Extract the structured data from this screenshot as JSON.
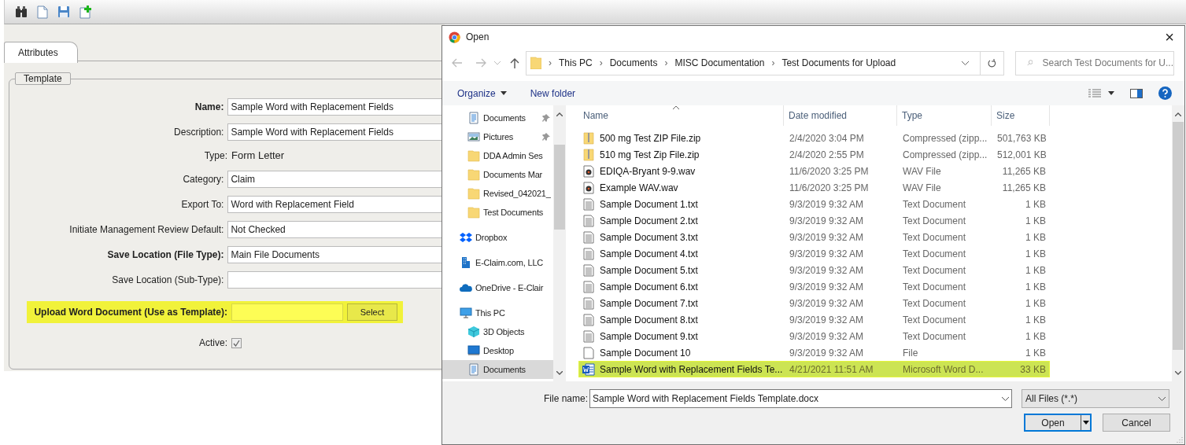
{
  "tabs": [
    {
      "label": "Attributes",
      "selected": true
    }
  ],
  "fieldset": {
    "legend": "Template"
  },
  "fields": [
    {
      "label": "Name:",
      "bold": true,
      "kind": "input",
      "value": "Sample Word with Replacement Fields"
    },
    {
      "label": "Description:",
      "bold": false,
      "kind": "input",
      "value": "Sample Word with Replacement Fields"
    },
    {
      "label": "Type:",
      "bold": false,
      "kind": "text",
      "value": "Form Letter"
    },
    {
      "label": "Category:",
      "bold": false,
      "kind": "input",
      "value": "Claim"
    },
    {
      "label": "Export To:",
      "bold": false,
      "kind": "input",
      "value": "Word with Replacement Field"
    },
    {
      "label": "Initiate Management Review Default:",
      "bold": false,
      "kind": "input",
      "value": "Not Checked"
    },
    {
      "label": "Save Location (File Type):",
      "bold": true,
      "kind": "input",
      "value": "Main File Documents"
    },
    {
      "label": "Save Location (Sub-Type):",
      "bold": false,
      "kind": "input"
    },
    {
      "label": "Upload Word Document (Use as Template):",
      "bold": true,
      "kind": "upload",
      "highlighted": true,
      "button": "Select"
    },
    {
      "label": "Active:",
      "bold": false,
      "kind": "checkbox",
      "checked": true
    }
  ],
  "dialog": {
    "title": "Open",
    "close": "×",
    "breadcrumb_separator": "›",
    "breadcrumb": [
      "This PC",
      "Documents",
      "MISC Documentation",
      "Test Documents for Upload"
    ],
    "search_placeholder": "Search Test Documents for U...",
    "commands": [
      {
        "label": "Organize",
        "menu": true
      },
      {
        "label": "New folder",
        "menu": false
      }
    ],
    "nav": [
      {
        "label": "Documents",
        "kind": "docs",
        "pinned": true,
        "selected": false
      },
      {
        "label": "Pictures",
        "kind": "pictures",
        "pinned": true,
        "selected": false
      },
      {
        "label": "DDA Admin Ses",
        "kind": "folder",
        "pinned": false,
        "selected": false
      },
      {
        "label": "Documents Mar",
        "kind": "folder",
        "pinned": false,
        "selected": false
      },
      {
        "label": "Revised_042021_",
        "kind": "folder",
        "pinned": false,
        "selected": false
      },
      {
        "label": "Test Documents",
        "kind": "folder",
        "pinned": false,
        "selected": false
      },
      {
        "label": "Dropbox",
        "kind": "dropbox",
        "pinned": false,
        "selected": false
      },
      {
        "label": "E-Claim.com, LLC",
        "kind": "building",
        "pinned": false,
        "selected": false
      },
      {
        "label": "OneDrive - E-Clair",
        "kind": "cloud",
        "pinned": false,
        "selected": false
      },
      {
        "label": "This PC",
        "kind": "pc",
        "pinned": false,
        "selected": false,
        "children": [
          {
            "label": "3D Objects",
            "kind": "cube",
            "pinned": false,
            "selected": false
          },
          {
            "label": "Desktop",
            "kind": "desktop",
            "pinned": false,
            "selected": false
          },
          {
            "label": "Documents",
            "kind": "docs",
            "pinned": false,
            "selected": true
          }
        ]
      }
    ],
    "columns": [
      "Name",
      "Date modified",
      "Type",
      "Size"
    ],
    "files": [
      {
        "name": "500 mg Test ZIP File.zip",
        "date": "2/4/2020 3:04 PM",
        "type": "Compressed (zipp...",
        "size": "501,763 KB",
        "kind": "zip",
        "selected": false
      },
      {
        "name": "510 mg Test Zip File.zip",
        "date": "2/4/2020 2:55 PM",
        "type": "Compressed (zipp...",
        "size": "512,001 KB",
        "kind": "zip",
        "selected": false
      },
      {
        "name": "EDIQA-Bryant  9-9.wav",
        "date": "11/6/2020 3:25 PM",
        "type": "WAV File",
        "size": "11,265 KB",
        "kind": "wav",
        "selected": false
      },
      {
        "name": "Example WAV.wav",
        "date": "11/6/2020 3:25 PM",
        "type": "WAV File",
        "size": "11,265 KB",
        "kind": "wav",
        "selected": false
      },
      {
        "name": "Sample Document 1.txt",
        "date": "9/3/2019 9:32 AM",
        "type": "Text Document",
        "size": "1 KB",
        "kind": "txt",
        "selected": false
      },
      {
        "name": "Sample Document 2.txt",
        "date": "9/3/2019 9:32 AM",
        "type": "Text Document",
        "size": "1 KB",
        "kind": "txt",
        "selected": false
      },
      {
        "name": "Sample Document 3.txt",
        "date": "9/3/2019 9:32 AM",
        "type": "Text Document",
        "size": "1 KB",
        "kind": "txt",
        "selected": false
      },
      {
        "name": "Sample Document 4.txt",
        "date": "9/3/2019 9:32 AM",
        "type": "Text Document",
        "size": "1 KB",
        "kind": "txt",
        "selected": false
      },
      {
        "name": "Sample Document 5.txt",
        "date": "9/3/2019 9:32 AM",
        "type": "Text Document",
        "size": "1 KB",
        "kind": "txt",
        "selected": false
      },
      {
        "name": "Sample Document 6.txt",
        "date": "9/3/2019 9:32 AM",
        "type": "Text Document",
        "size": "1 KB",
        "kind": "txt",
        "selected": false
      },
      {
        "name": "Sample Document 7.txt",
        "date": "9/3/2019 9:32 AM",
        "type": "Text Document",
        "size": "1 KB",
        "kind": "txt",
        "selected": false
      },
      {
        "name": "Sample Document 8.txt",
        "date": "9/3/2019 9:32 AM",
        "type": "Text Document",
        "size": "1 KB",
        "kind": "txt",
        "selected": false
      },
      {
        "name": "Sample Document 9.txt",
        "date": "9/3/2019 9:32 AM",
        "type": "Text Document",
        "size": "1 KB",
        "kind": "txt",
        "selected": false
      },
      {
        "name": "Sample Document 10",
        "date": "9/3/2019 9:32 AM",
        "type": "File",
        "size": "1 KB",
        "kind": "file",
        "selected": false
      },
      {
        "name": "Sample Word with Replacement Fields Te...",
        "date": "4/21/2021 11:51 AM",
        "type": "Microsoft Word D...",
        "size": "33 KB",
        "kind": "word",
        "selected": true
      }
    ],
    "file_name_label": "File name:",
    "file_name": "Sample Word with Replacement Fields Template.docx",
    "filter": "All Files (*.*)",
    "buttons": [
      {
        "label": "Open",
        "kind": "split"
      },
      {
        "label": "Cancel",
        "kind": "plain"
      }
    ]
  }
}
